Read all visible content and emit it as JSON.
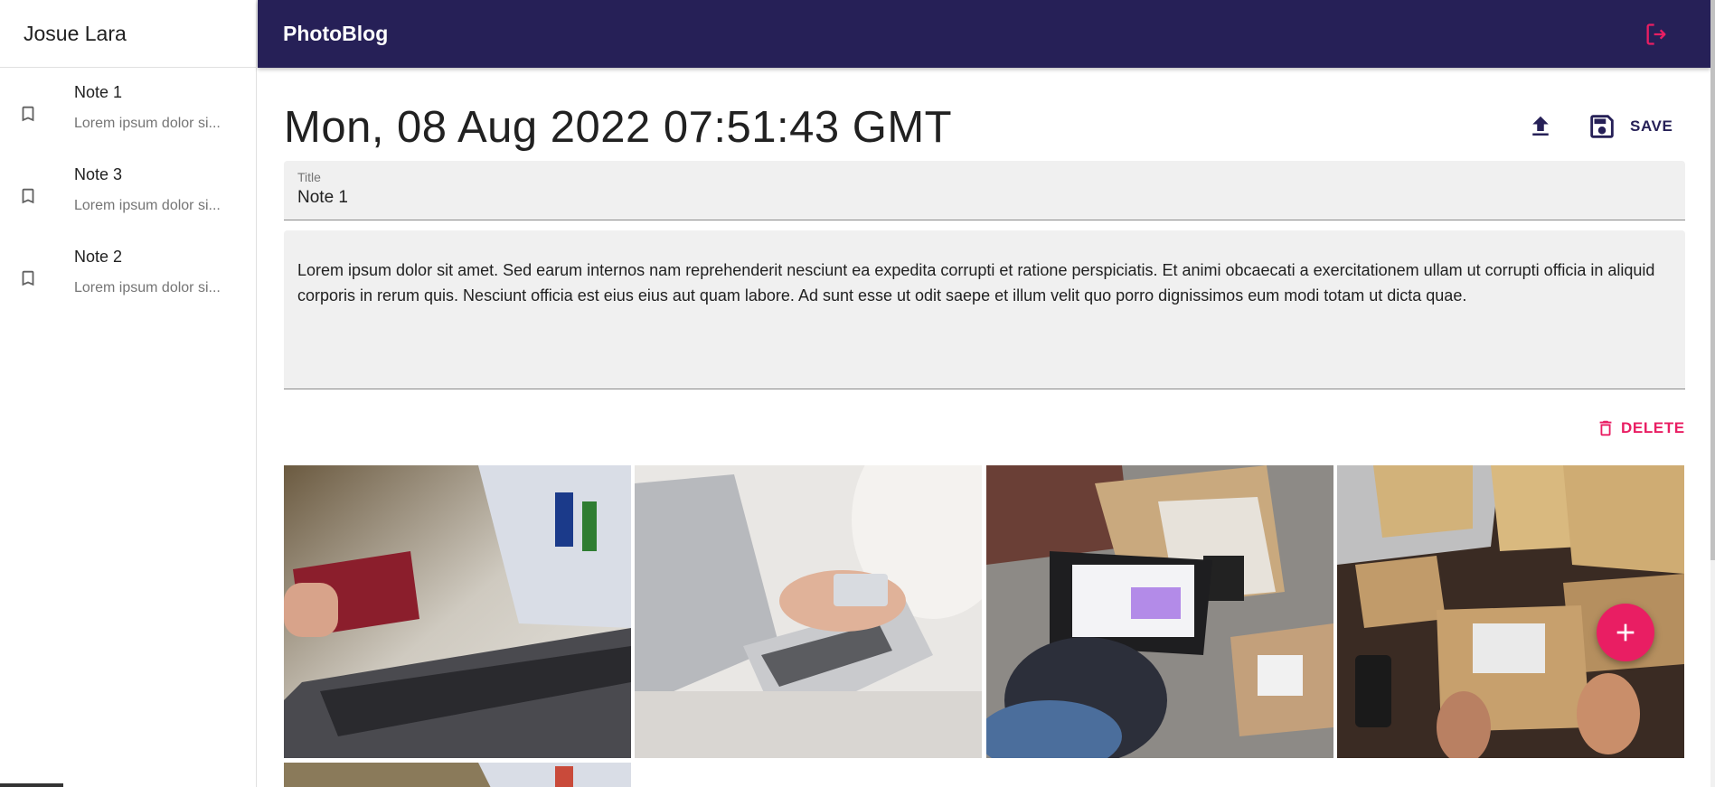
{
  "sidebar": {
    "user_name": "Josue Lara",
    "notes": [
      {
        "title": "Note 1",
        "snippet": "Lorem ipsum dolor si..."
      },
      {
        "title": "Note 3",
        "snippet": "Lorem ipsum dolor si..."
      },
      {
        "title": "Note 2",
        "snippet": "Lorem ipsum dolor si..."
      }
    ]
  },
  "appbar": {
    "title": "PhotoBlog",
    "logout_icon": "logout-icon"
  },
  "editor": {
    "date_heading": "Mon, 08 Aug 2022 07:51:43 GMT",
    "upload_icon": "upload-icon",
    "save_label": "SAVE",
    "title_label": "Title",
    "title_value": "Note 1",
    "body_value": "Lorem ipsum dolor sit amet. Sed earum internos nam reprehenderit nesciunt ea expedita corrupti et ratione perspiciatis. Et animi obcaecati a exercitationem ullam ut corrupti officia in aliquid corporis in rerum quis. Nesciunt officia est eius eius aut quam labore. Ad sunt esse ut odit saepe et illum velit quo porro dignissimos eum modi totam ut dicta quae.",
    "delete_label": "DELETE"
  },
  "colors": {
    "appbar": "#262057",
    "accent": "#e91e63",
    "field_bg": "#f0f0f0"
  },
  "photos": [
    {
      "name": "photo-credit-card-laptop"
    },
    {
      "name": "photo-laptop-card-payment"
    },
    {
      "name": "photo-laptop-boxes-shoes"
    },
    {
      "name": "photo-packages-boxes"
    },
    {
      "name": "photo-credit-card-laptop-2"
    }
  ],
  "fab_icon": "add-icon"
}
